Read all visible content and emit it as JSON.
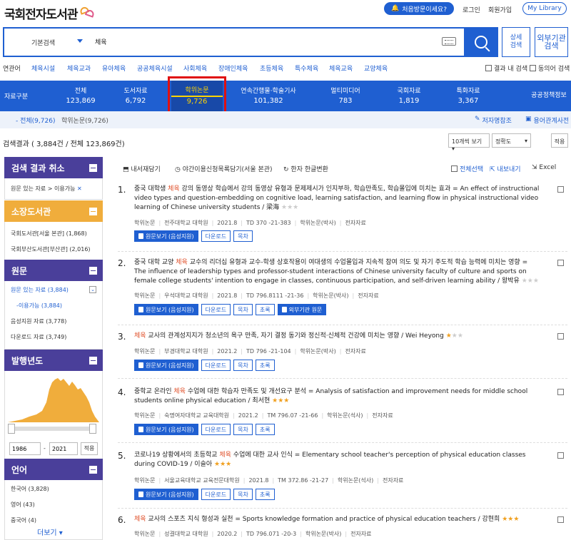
{
  "header": {
    "logo": "국회전자도서관",
    "first_visit": "처음방문이세요?",
    "login": "로그인",
    "signup": "회원가입",
    "my_library": "My Library"
  },
  "search": {
    "type": "기본검색",
    "query": "체육",
    "advanced": "상세\n검색",
    "external": "외부기관\n검색"
  },
  "related": {
    "label": "연관어",
    "terms": [
      "체육시설",
      "체육교과",
      "유아체육",
      "공공체육시설",
      "사회체육",
      "장애인체육",
      "초등체육",
      "특수체육",
      "체육교육",
      "교양체육"
    ],
    "within_results": "결과 내 검색",
    "synonym": "동의어 검색"
  },
  "tabs": {
    "category_label": "자료구분",
    "items": [
      {
        "label": "전체",
        "count": "123,869"
      },
      {
        "label": "도서자료",
        "count": "6,792"
      },
      {
        "label": "학위논문",
        "count": "9,726"
      },
      {
        "label": "연속간행물·학술기사",
        "count": "101,382"
      },
      {
        "label": "멀티미디어",
        "count": "783"
      },
      {
        "label": "국회자료",
        "count": "1,819"
      },
      {
        "label": "특화자료",
        "count": "3,367"
      },
      {
        "label": "공공정책정보",
        "count": ""
      }
    ],
    "sub_all": "- 전체(9,726)",
    "sub_thesis": "학위논문(9,726)",
    "author_ref": "저자명참조",
    "term_dict": "용어관계사전"
  },
  "results_bar": {
    "count_text": "검색결과 ( 3,884건 / 전체 123,869건)",
    "per_page": "10개씩 보기",
    "sort": "정확도",
    "apply": "적용"
  },
  "sidebar": {
    "cancel_title": "검색 결과 취소",
    "cancel_item": "원문 있는 자료 > 이용가능",
    "library_title": "소장도서관",
    "libraries": [
      "국회도서관[서울 본관] (1,868)",
      "국회부산도서관[부산관] (2,016)"
    ],
    "original_title": "원문",
    "original_items": [
      "원문 있는 자료 (3,884)",
      "-이용가능 (3,884)",
      "음성지원 자료 (3,778)",
      "다운로드 자료 (3,749)"
    ],
    "year_title": "발행년도",
    "year_from": "1986",
    "year_to": "2021",
    "year_apply": "적용",
    "lang_title": "언어",
    "languages": [
      "한국어 (3,828)",
      "영어 (43)",
      "중국어 (4)"
    ],
    "more": "더보기"
  },
  "toolbar": {
    "save": "내서재담기",
    "night": "야간이용신청목록담기(서울 본관)",
    "hanja": "한자 한글변환",
    "select_all": "전체선택",
    "export": "내보내기",
    "excel": "Excel"
  },
  "results": [
    {
      "num": "1.",
      "pre": "중국 대학생 ",
      "kw": "체육",
      "post": " 강의 동영상 학습에서 강의 동영상 유형과 문제제시가 인지부하, 학습만족도, 학습몰입에 미치는 효과 = An effect of instructional video types and question-embedding on cognitive load, learning satisfaction, and learning flow in physical instructional video learning of Chinese university students / 梁海",
      "stars": 0,
      "meta": "학위논문 | 전주대학교 대학원 | 2021.8 | TD 370 -21-383 | 학위논문(박사) | 전자자료",
      "buttons": [
        "원문보기 (음성지원)",
        "다운로드",
        "목차"
      ]
    },
    {
      "num": "2.",
      "pre": "중국 대학 교양 ",
      "kw": "체육",
      "post": " 교수의 리더십 유형과 교수-학생 상호작용이 여대생의 수업몰입과 지속적 참여 의도 및 자기 주도적 학습 능력에 미치는 영향 = The influence of leadership types and professor-student interactions of Chinese university faculty of culture and sports on female college students' intention to engage in classes, continuous participation, and self-driven learning ability / 왕박유",
      "stars": 0,
      "meta": "학위논문 | 우석대학교 대학원 | 2021.8 | TD 796.8111 -21-36 | 학위논문(박사) | 전자자료",
      "buttons": [
        "원문보기 (음성지원)",
        "다운로드",
        "목차",
        "초록",
        "외부기관 원문"
      ]
    },
    {
      "num": "3.",
      "pre": "",
      "kw": "체육",
      "post": " 교사의 관계성지지가 청소년의 욕구 만족, 자기 결정 동기와 정신적·신체적 건강에 미치는 영향 / Wei Heyong",
      "stars": 1,
      "meta": "학위논문 | 부경대학교 대학원 | 2021.2 | TD 796 -21-104 | 학위논문(박사) | 전자자료",
      "buttons": [
        "원문보기 (음성지원)",
        "다운로드",
        "목차",
        "초록"
      ]
    },
    {
      "num": "4.",
      "pre": "중학교 온라인 ",
      "kw": "체육",
      "post": " 수업에 대한 학습자 만족도 및 개선요구 분석 = Analysis of satisfaction and improvement needs for middle school students online physical education / 최서현",
      "stars": 3,
      "meta": "학위논문 | 숙명여자대학교 교육대학원 | 2021.2 | TM 796.07 -21-66 | 학위논문(석사) | 전자자료",
      "buttons": [
        "원문보기 (음성지원)",
        "다운로드",
        "목차",
        "초록"
      ]
    },
    {
      "num": "5.",
      "pre": "코로나19 상황에서의 초등학교 ",
      "kw": "체육",
      "post": " 수업에 대한 교사 인식 = Elementary school teacher's perception of physical education classes during COVID-19 / 이슬아",
      "stars": 3,
      "meta": "학위논문 | 서울교육대학교 교육전문대학원 | 2021.8 | TM 372.86 -21-27 | 학위논문(석사) | 전자자료",
      "buttons": [
        "원문보기 (음성지원)",
        "다운로드",
        "목차",
        "초록"
      ]
    },
    {
      "num": "6.",
      "pre": "",
      "kw": "체육",
      "post": " 교사의 스포츠 지식 형성과 실천 = Sports knowledge formation and practice of physical education teachers / 강현희",
      "stars": 3,
      "meta": "학위논문 | 성결대학교 대학원 | 2020.2 | TD 796.071 -20-3 | 학위논문(박사) | 전자자료",
      "buttons": []
    }
  ]
}
